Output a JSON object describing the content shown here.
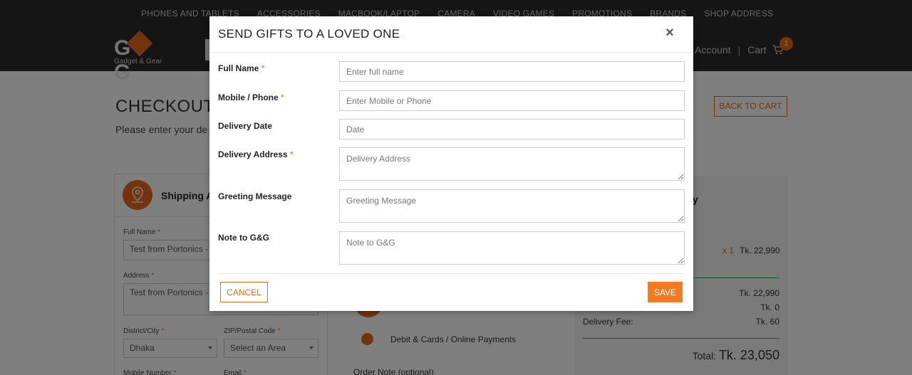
{
  "header": {
    "nav": [
      "PHONES AND TABLETS",
      "ACCESSORIES",
      "MACBOOK/LAPTOP",
      "CAMERA",
      "VIDEO GAMES",
      "PROMOTIONS",
      "BRANDS",
      "SHOP ADDRESS"
    ],
    "logo_text": "G&G",
    "logo_sub": "Gadget & Gear",
    "account_label": "Account",
    "separator": "|",
    "cart_label": "Cart",
    "cart_count": "1"
  },
  "checkout": {
    "title": "CHECKOUT",
    "subtitle": "Please enter your de",
    "back_to_cart": "BACK TO CART",
    "shipping": {
      "title": "Shipping A",
      "full_name_label": "Full Name",
      "full_name_value": "Test from Portonics -",
      "address_label": "Address",
      "address_value": "Test from Portonics -",
      "district_label": "District/City",
      "district_value": "Dhaka",
      "zip_label": "ZIP/Postal Code",
      "zip_value": "Select an Area",
      "mobile_label": "Mobile Number",
      "email_label": "Email",
      "required_mark": "*"
    },
    "payment": {
      "option_label": "Debit & Cards / Online Payments",
      "order_note_label": "Order Note (optional)"
    },
    "summary": {
      "title_fragment": "y",
      "qty": "x 1",
      "item_price": "Tk. 22,990",
      "subtotal": "Tk. 22,990",
      "discount": "Tk. 0",
      "delivery_fee_label": "Delivery Fee:",
      "delivery_fee": "Tk. 60",
      "total_label": "Total:",
      "total_value": "Tk. 23,050"
    }
  },
  "modal": {
    "title": "SEND GIFTS TO A LOVED ONE",
    "close_glyph": "×",
    "required_mark": "*",
    "fields": {
      "full_name": {
        "label": "Full Name",
        "placeholder": "Enter full name"
      },
      "mobile": {
        "label": "Mobile / Phone",
        "placeholder": "Enter Mobile or Phone"
      },
      "delivery_date": {
        "label": "Delivery Date",
        "placeholder": "Date"
      },
      "delivery_address": {
        "label": "Delivery Address",
        "placeholder": "Delivery Address"
      },
      "greeting": {
        "label": "Greeting Message",
        "placeholder": "Greeting Message"
      },
      "note": {
        "label": "Note to G&G",
        "placeholder": "Note to G&G"
      }
    },
    "cancel_label": "CANCEL",
    "save_label": "SAVE"
  },
  "colors": {
    "accent": "#e2681b",
    "save_button": "#f47a1f",
    "header_bg": "#2a2a2a",
    "overlay": "rgba(0,0,0,0.5)"
  }
}
